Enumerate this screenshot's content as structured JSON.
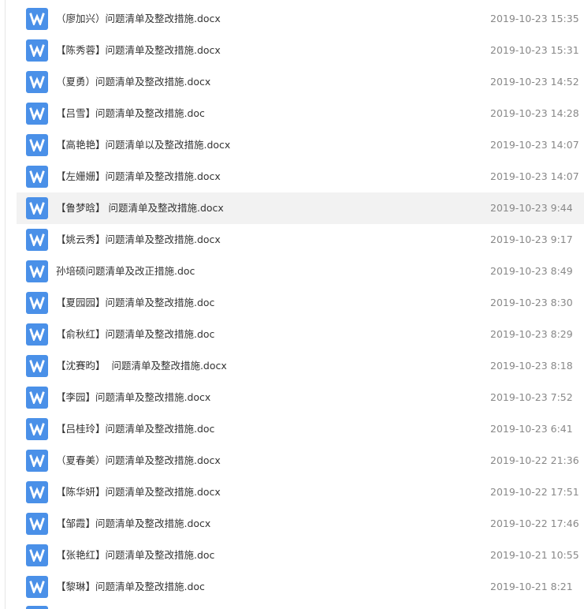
{
  "files": [
    {
      "name": "（廖加兴）问题清单及整改措施.docx",
      "date": "2019-10-23 15:35",
      "icon": "word-doc-icon"
    },
    {
      "name": "【陈秀蓉】问题清单及整改措施.docx",
      "date": "2019-10-23 15:31",
      "icon": "word-doc-icon"
    },
    {
      "name": "（夏勇）问题清单及整改措施.docx",
      "date": "2019-10-23 14:52",
      "icon": "word-doc-icon"
    },
    {
      "name": "【吕雪】问题清单及整改措施.doc",
      "date": "2019-10-23 14:28",
      "icon": "word-doc-icon"
    },
    {
      "name": "【高艳艳】问题清单以及整改措施.docx",
      "date": "2019-10-23 14:07",
      "icon": "word-doc-icon"
    },
    {
      "name": "【左姗姗】问题清单及整改措施.docx",
      "date": "2019-10-23 14:07",
      "icon": "word-doc-icon"
    },
    {
      "name": "【鲁梦晗】 问题清单及整改措施.docx",
      "date": "2019-10-23 9:44",
      "icon": "word-doc-icon",
      "hovered": true
    },
    {
      "name": "【姚云秀】问题清单及整改措施.docx",
      "date": "2019-10-23 9:17",
      "icon": "word-doc-icon"
    },
    {
      "name": "孙培硕问题清单及改正措施.doc",
      "date": "2019-10-23 8:49",
      "icon": "word-doc-icon"
    },
    {
      "name": "【夏园园】问题清单及整改措施.doc",
      "date": "2019-10-23 8:30",
      "icon": "word-doc-icon"
    },
    {
      "name": "【俞秋红】问题清单及整改措施.doc",
      "date": "2019-10-23 8:29",
      "icon": "word-doc-icon"
    },
    {
      "name": "【沈賽昀】  问题清单及整改措施.docx",
      "date": "2019-10-23 8:18",
      "icon": "word-doc-icon"
    },
    {
      "name": "【李园】问题清单及整改措施.docx",
      "date": "2019-10-23 7:52",
      "icon": "word-doc-icon"
    },
    {
      "name": "【吕桂玲】问题清单及整改措施.doc",
      "date": "2019-10-23 6:41",
      "icon": "word-doc-icon"
    },
    {
      "name": "（夏春美）问题清单及整改措施.docx",
      "date": "2019-10-22 21:36",
      "icon": "word-doc-icon"
    },
    {
      "name": "【陈华妍】问题清单及整改措施.docx",
      "date": "2019-10-22 17:51",
      "icon": "word-doc-icon"
    },
    {
      "name": "【邹霞】问题清单及整改措施.docx",
      "date": "2019-10-22 17:46",
      "icon": "word-doc-icon"
    },
    {
      "name": "【张艳红】问题清单及整改措施.doc",
      "date": "2019-10-21 10:55",
      "icon": "word-doc-icon"
    },
    {
      "name": "【黎琳】问题清单及整改措施.doc",
      "date": "2019-10-21 8:21",
      "icon": "word-doc-icon"
    }
  ],
  "colors": {
    "icon_bg": "#4a90e8",
    "name_text": "#333333",
    "date_text": "#888888",
    "hover_bg": "#f2f2f2"
  }
}
